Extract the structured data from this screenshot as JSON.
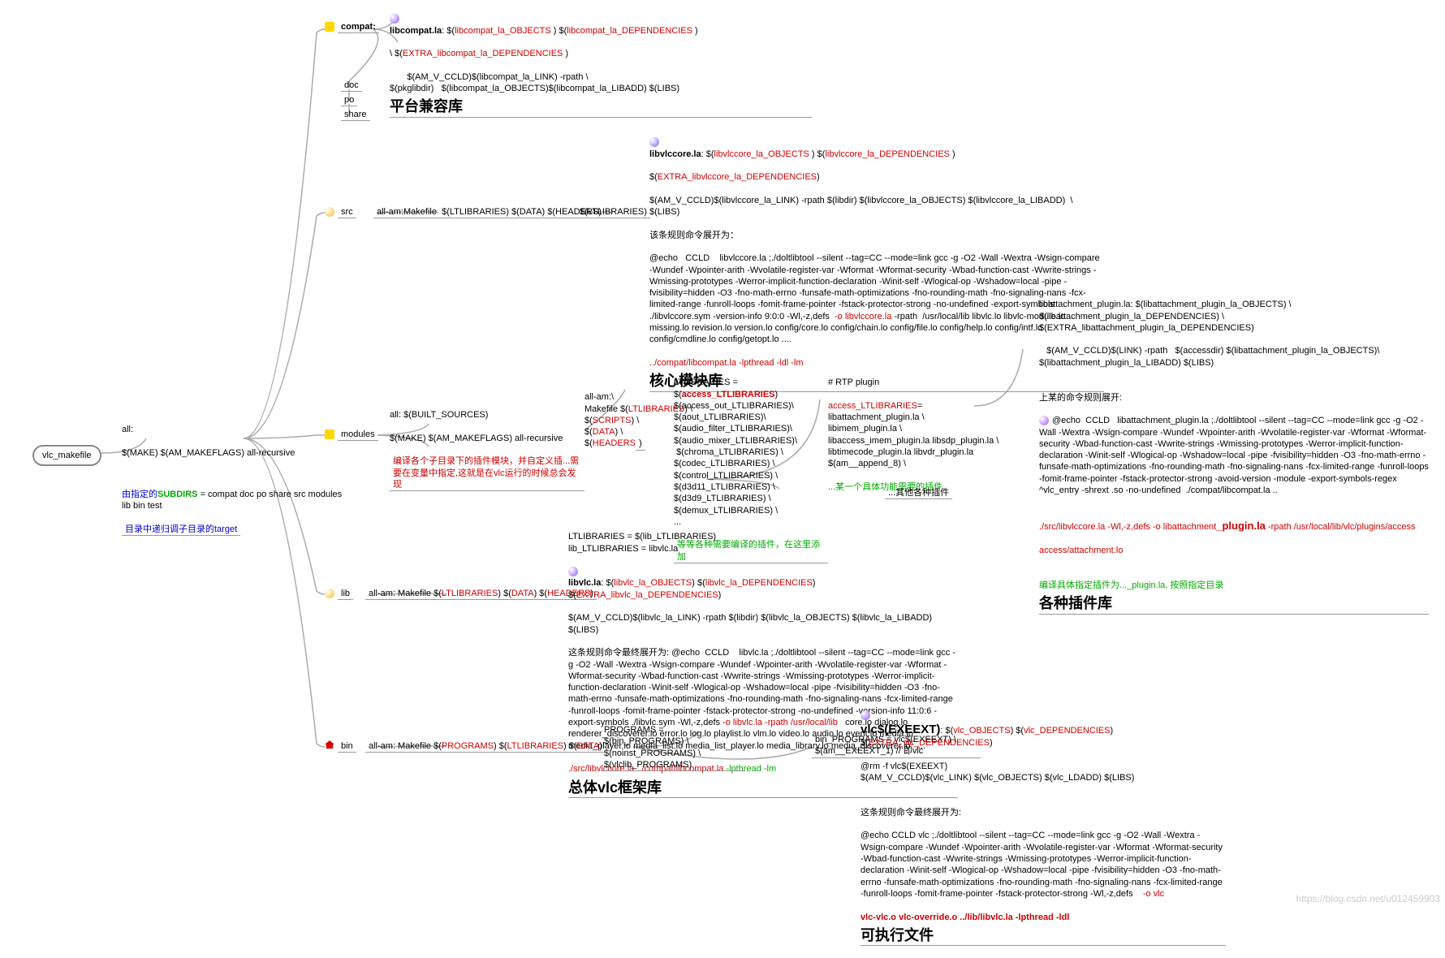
{
  "root": "vlc_makefile",
  "all_block": {
    "line1": "all:",
    "line2": "$(MAKE) $(AM_MAKEFLAGS) all-recursive",
    "line3_pre": "由指定的",
    "line3_sub": "SUBDIRS",
    "line3_post": " = compat doc po share src modules lib bin test",
    "line4": "目录中递归调子目录的target"
  },
  "compat": {
    "label": "compat:",
    "libcompat": "libcompat.la",
    "libcompat_after": ": $(",
    "obj": "libcompat_la_OBJECTS",
    "mid1": " ) $(",
    "dep": "libcompat_la_DEPENDENCIES",
    "mid2": " )",
    "extra_pre": "\\ $(",
    "extra": "EXTRA_libcompat_la_DEPENDENCIES",
    "extra_post": " )",
    "cmd": "       $(AM_V_CCLD)$(libcompat_la_LINK) -rpath \\\n$(pkglibdir)   $(libcompat_la_OBJECTS)$(libcompat_la_LIBADD) $(LIBS)",
    "title": "平台兼容库"
  },
  "simple": {
    "doc": "doc",
    "po": "po",
    "share": "share"
  },
  "src": {
    "label": "src",
    "mid": "all-am:Makefile  $(LTLIBRARIES) $(DATA) $(HEADERS)",
    "lt": "$(LTLIBRARIES)",
    "core_label": "libvlccore.la",
    "core_after": ": $(",
    "core_obj": "libvlccore_la_OBJECTS",
    "core_mid1": " ) $(",
    "core_dep": "libvlccore_la_DEPENDENCIES",
    "core_mid2": " )",
    "core_extra_pre": "$(",
    "core_extra": "EXTRA_libvlccore_la_DEPENDENCIES",
    "core_extra_post": ")",
    "core_cmd": "$(AM_V_CCLD)$(libvlccore_la_LINK) -rpath $(libdir) $(libvlccore_la_OBJECTS) $(libvlccore_la_LIBADD)  \\\n$(LIBS)",
    "core_rule": "该条规则命令展开为：",
    "core_expand": "@echo   CCLD    libvlccore.la ;./doltlibtool --silent --tag=CC --mode=link gcc -g -O2 -Wall -Wextra -Wsign-compare -Wundef -Wpointer-arith -Wvolatile-register-var -Wformat -Wformat-security -Wbad-function-cast -Wwrite-strings -Wmissing-prototypes -Werror-implicit-function-declaration -Winit-self -Wlogical-op -Wshadow=local -pipe -fvisibility=hidden -O3 -fno-math-errno -funsafe-math-optimizations -fno-rounding-math -fno-signaling-nans -fcx-limited-range -funroll-loops -fomit-frame-pointer -fstack-protector-strong -no-undefined -export-symbols ./libvlccore.sym -version-info 9:0:0 -Wl,-z,defs ",
    "core_red": " -o libvlccore.la",
    "core_expand2": " -rpath  /usr/local/lib libvlc.lo libvlc-module.lo missing.lo revision.lo version.lo config/core.lo config/chain.lo config/file.lo config/help.lo config/intf.lo config/cmdline.lo config/getopt.lo ....",
    "core_tail": "../compat/libcompat.la -lpthread -ldl -lm",
    "core_title": "核心模块库"
  },
  "modules": {
    "label": "modules",
    "all1": "all: $(BUILT_SOURCES)",
    "all2": "$(MAKE) $(AM_MAKEFLAGS) all-recursive",
    "note": "编译各个子目录下的插件模块，并自定义插...需要在变量中指定,这就是在vlc运行的时候总会发现",
    "allam": "all-am:\\\nMakefile $(",
    "allam_lt": "LTLIBRARIES",
    "allam2": ") \\\n$(",
    "allam_sc": "SCRIPTS",
    "allam3": ") \\\n$(",
    "allam_da": "DATA",
    "allam4": ") \\\n$(",
    "allam_hd": "HEADERS",
    "allam5": ")",
    "lt_block": "LTLIBRARIES = $(",
    "lt_red": "access_LTLIBRARIES",
    "lt_block2": ")\n$(access_out_LTLIBRARIES)\\\n$(aout_LTLIBRARIES)\\\n$(audio_filter_LTLIBRARIES)\\\n$(audio_mixer_LTLIBRARIES)\\\n $(chroma_LTLIBRARIES) \\\n$(codec_LTLIBRARIES) \\\n$(control_LTLIBRARIES) \\\n$(d3d11_LTLIBRARIES) \\\n$(d3d9_LTLIBRARIES) \\\n$(demux_LTLIBRARIES) \\\n...",
    "lt_green": "等等各种需要编译的插件，在这里添加",
    "rtp": "# RTP plugin",
    "access_lt": "access_LTLIBRARIES",
    "access_lt_eq": "= libattachment_plugin.la \\\nlibimem_plugin.la \\\nlibaccess_imem_plugin.la libsdp_plugin.la \\\nlibtimecode_plugin.la libvdr_plugin.la $(am__append_8) \\",
    "access_green": "...某一个具体功能需要的插件",
    "other": "...其他各种插件",
    "plugin1": "libattachment_plugin.la: $(libattachment_plugin_la_OBJECTS) \\\n$(libattachment_plugin_la_DEPENDENCIES) \\ $(EXTRA_libattachment_plugin_la_DEPENDENCIES)\n\n   $(AM_V_CCLD)$(LINK) -rpath   $(accessdir) $(libattachment_plugin_la_OBJECTS)\\\n$(libattachment_plugin_la_LIBADD) $(LIBS)",
    "plugin_rule": "上某的命令规则展开:",
    "plugin_expand": "@echo  CCLD   libattachment_plugin.la ;./doltlibtool --silent --tag=CC --mode=link gcc -g -O2 -Wall -Wextra -Wsign-compare -Wundef -Wpointer-arith -Wvolatile-register-var -Wformat -Wformat-security -Wbad-function-cast -Wwrite-strings -Wmissing-prototypes -Werror-implicit-function-declaration -Winit-self -Wlogical-op -Wshadow=local -pipe -fvisibility=hidden -O3 -fno-math-errno -funsafe-math-optimizations -fno-rounding-math -fno-signaling-nans -fcx-limited-range -funroll-loops -fomit-frame-pointer -fstack-protector-strong -avoid-version -module -export-symbols-regex ^vlc_entry -shrext .so -no-undefined  ./compat/libcompat.la ..\n",
    "plugin_red1": "./src/libvlccore.la -Wl,-z,defs ",
    "plugin_red2": "-o libattachment",
    "plugin_red3": "_plugin.la",
    "plugin_red4": " -rpath /usr/local/lib/vlc/plugins/access",
    "plugin_red5": "access/attachment.lo",
    "plugin_green": "编译具体指定插件为..._plugin.la, 按照指定目录",
    "plugin_title": "各种插件库"
  },
  "lib": {
    "label": "lib",
    "mid": "all-am: Makefile $(",
    "mid_lt": "LTLIBRARIES",
    "mid2": ") $(",
    "mid_da": "DATA",
    "mid3": ") $(",
    "mid_hd": "HEADERS",
    "mid4": ")",
    "lt1": "LTLIBRARIES = $(lib_LTLIBRARIES)\nlib_LTLIBRARIES = libvlc.la",
    "libvlc": "libvlc.la",
    "libvlc_after": ": $(",
    "lv_obj": "libvlc_la_OBJECTS",
    "lv_mid1": ") $(",
    "lv_dep": "libvlc_la_DEPENDENCIES",
    "lv_mid2": ") $(",
    "lv_extra": "EXTRA_libvlc_la_DEPENDENCIES",
    "lv_mid3": ")",
    "lv_cmd": "$(AM_V_CCLD)$(libvlc_la_LINK) -rpath $(libdir) $(libvlc_la_OBJECTS) $(libvlc_la_LIBADD) $(LIBS)",
    "lv_rule": "这条规则命令最终展开为: @echo  CCLD    libvlc.la ;./doltlibtool --silent --tag=CC --mode=link gcc -g -O2 -Wall -Wextra -Wsign-compare -Wundef -Wpointer-arith -Wvolatile-register-var -Wformat -Wformat-security -Wbad-function-cast -Wwrite-strings -Wmissing-prototypes -Werror-implicit-function-declaration -Winit-self -Wlogical-op -Wshadow=local -pipe -fvisibility=hidden -O3 -fno-math-errno -funsafe-math-optimizations -fno-rounding-math -fno-signaling-nans -fcx-limited-range -funroll-loops -fomit-frame-pointer -fstack-protector-strong -no-undefined -version-info 11:0:6 -export-symbols ./libvlc.sym -Wl,-z,defs ",
    "lv_red1": "-o libvlc.la -rpath /usr/local/lib",
    "lv_rule2": "   core.lo dialog.lo renderer_discoverer.lo error.lo log.lo playlist.lo vlm.lo video.lo audio.lo event.lo media.lo media_player.lo media_list.lo media_list_player.lo media_library.lo media_discoverer.lo   ...",
    "lv_red2": "./src/libvlccore.la ../compat/libcompat.la",
    "lv_green": " -lpthread -lm",
    "lv_title": "总体vlc框架库"
  },
  "bin": {
    "label": "bin",
    "mid": "all-am: Makefile $(",
    "mid_pr": "PROGRAMS",
    "mid2": ") $(",
    "mid_lt": "LTLIBRARIES",
    "mid3": ") $(",
    "mid_da": "DATA",
    "mid4": ")",
    "prog": "PROGRAMS = $(bin_PROGRAMS) \\\n$(noinst_PROGRAMS) \\\n$(vlclib_PROGRAMS)",
    "binprog": "bin_PROGRAMS = vlc$(EXEEXT) \\\n$(am__EXEEXT_1) // 即vlc",
    "vlc": "vlc$(EXEEXT)",
    "vlc_after": ": $(",
    "vo": "vlc_OBJECTS",
    "vm1": ") $(",
    "vd": "vlc_DEPENDENCIES",
    "vm2": ") $(",
    "ve": "EXTRA_vlc_DEPENDENCIES",
    "vm3": ")",
    "cmd1": "@rm -f vlc$(EXEEXT)\n$(AM_V_CCLD)$(vlc_LINK) $(vlc_OBJECTS) $(vlc_LDADD) $(LIBS)",
    "rule": "这条规则命令最终展开为:",
    "expand": "@echo CCLD vlc ;./doltlibtool --silent --tag=CC --mode=link gcc -g -O2 -Wall -Wextra -Wsign-compare -Wundef -Wpointer-arith -Wvolatile-register-var -Wformat -Wformat-security -Wbad-function-cast -Wwrite-strings -Wmissing-prototypes -Werror-implicit-function-declaration -Winit-self -Wlogical-op -Wshadow=local -pipe -fvisibility=hidden -O3 -fno-math-errno -funsafe-math-optimizations -fno-rounding-math -fno-signaling-nans -fcx-limited-range -funroll-loops -fomit-frame-pointer -fstack-protector-strong -Wl,-z,defs  ",
    "red1": "  -o vlc ",
    "red2": "vlc-vlc.o vlc-override.o ../lib/libvlc.la -lpthread -ldl",
    "title": "可执行文件"
  },
  "wm": "https://blog.csdn.net/u012459903"
}
